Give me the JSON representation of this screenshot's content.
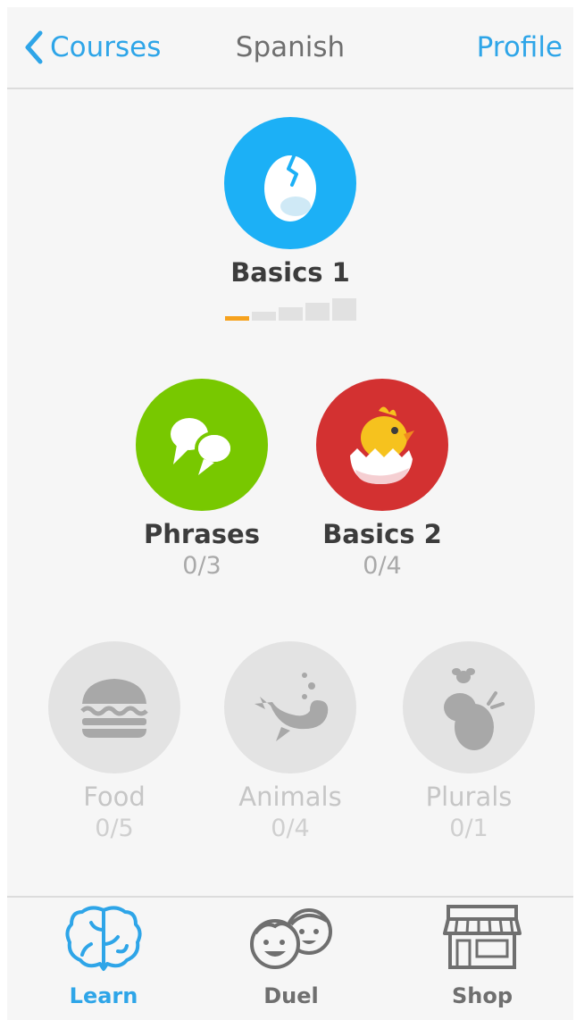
{
  "nav": {
    "back_label": "Courses",
    "title": "Spanish",
    "profile_label": "Profile"
  },
  "skills": {
    "basics1": {
      "name": "Basics 1",
      "strength_filled": 1,
      "strength_total": 5,
      "color": "#1cb0f6",
      "icon": "egg-icon"
    },
    "phrases": {
      "name": "Phrases",
      "progress": "0/3",
      "color": "#78c800",
      "icon": "speech-bubbles-icon"
    },
    "basics2": {
      "name": "Basics 2",
      "progress": "0/4",
      "color": "#d33131",
      "icon": "hatching-chick-icon"
    },
    "food": {
      "name": "Food",
      "progress": "0/5",
      "locked": true,
      "icon": "burger-icon"
    },
    "animals": {
      "name": "Animals",
      "progress": "0/4",
      "locked": true,
      "icon": "whale-icon"
    },
    "plurals": {
      "name": "Plurals",
      "progress": "0/1",
      "locked": true,
      "icon": "bees-icon"
    }
  },
  "tabs": {
    "learn": {
      "label": "Learn",
      "active": true,
      "icon": "brain-icon"
    },
    "duel": {
      "label": "Duel",
      "active": false,
      "icon": "faces-icon"
    },
    "shop": {
      "label": "Shop",
      "active": false,
      "icon": "storefront-icon"
    }
  },
  "colors": {
    "accent": "#2ea5e8",
    "strength_fill": "#f6a21e",
    "locked_circle": "#e3e3e3",
    "locked_icon": "#a8a8a8"
  }
}
